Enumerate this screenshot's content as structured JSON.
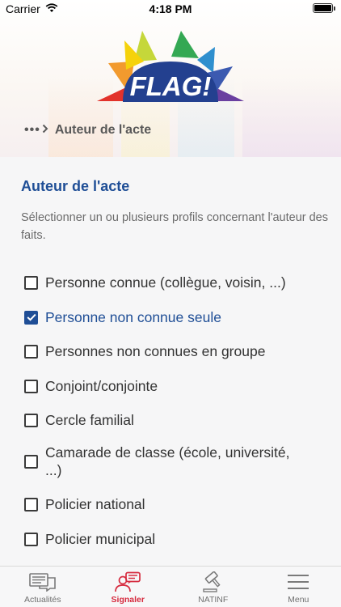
{
  "status_bar": {
    "carrier": "Carrier",
    "time": "4:18 PM"
  },
  "header": {
    "logo_text": "FLAG!",
    "breadcrumb_ellipsis": "•••",
    "breadcrumb_current": "Auteur de l'acte"
  },
  "section": {
    "title": "Auteur de l'acte",
    "description": "Sélectionner un ou plusieurs profils concernant l'auteur des faits."
  },
  "options": [
    {
      "label": "Personne connue (collègue, voisin, ...)",
      "checked": false
    },
    {
      "label": "Personne non connue seule",
      "checked": true
    },
    {
      "label": "Personnes non connues en groupe",
      "checked": false
    },
    {
      "label": "Conjoint/conjointe",
      "checked": false
    },
    {
      "label": "Cercle familial",
      "checked": false
    },
    {
      "label": "Camarade de classe (école, université, ...)",
      "checked": false
    },
    {
      "label": "Policier national",
      "checked": false
    },
    {
      "label": "Policier municipal",
      "checked": false
    }
  ],
  "tabs": [
    {
      "label": "Actualités",
      "icon": "news-icon",
      "active": false
    },
    {
      "label": "Signaler",
      "icon": "report-icon",
      "active": true
    },
    {
      "label": "NATINF",
      "icon": "gavel-icon",
      "active": false
    },
    {
      "label": "Menu",
      "icon": "menu-icon",
      "active": false
    }
  ],
  "colors": {
    "accent": "#1f4e96",
    "active_tab": "#d62b3f"
  }
}
